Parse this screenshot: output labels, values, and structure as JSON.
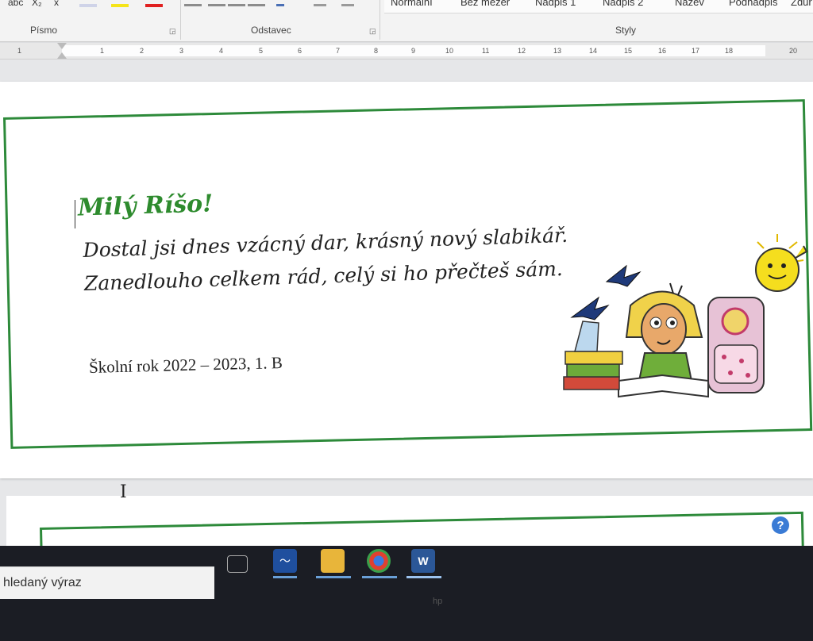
{
  "ribbon": {
    "groups": [
      "Písmo",
      "Odstavec",
      "Styly"
    ],
    "styles": [
      "Normální",
      "Bez mezer",
      "Nadpis 1",
      "Nadpis 2",
      "Název",
      "Podnadpis",
      "Zdůr"
    ],
    "subscript_label": "X₂",
    "clear_label": "x"
  },
  "ruler": {
    "ticks": [
      "1",
      "1",
      "2",
      "3",
      "4",
      "5",
      "6",
      "7",
      "8",
      "9",
      "10",
      "11",
      "12",
      "13",
      "14",
      "15",
      "16",
      "17",
      "18",
      "20"
    ]
  },
  "document": {
    "greeting": "Milý Ríšo!",
    "poem_line_1": "Dostal jsi dnes vzácný dar, krásný nový slabikář.",
    "poem_line_2": "Zanedlouho celkem rád, celý si ho přečteš sám.",
    "school_year": "Školní rok 2022 – 2023, 1. B",
    "accent_color": "#2d8a3a"
  },
  "taskbar": {
    "search_placeholder": "hledaný výraz",
    "icons": [
      "task-view-icon",
      "edge-icon",
      "file-explorer-icon",
      "chrome-icon",
      "word-icon"
    ],
    "word_label": "W",
    "help_label": "?",
    "brand_label": "hp"
  }
}
